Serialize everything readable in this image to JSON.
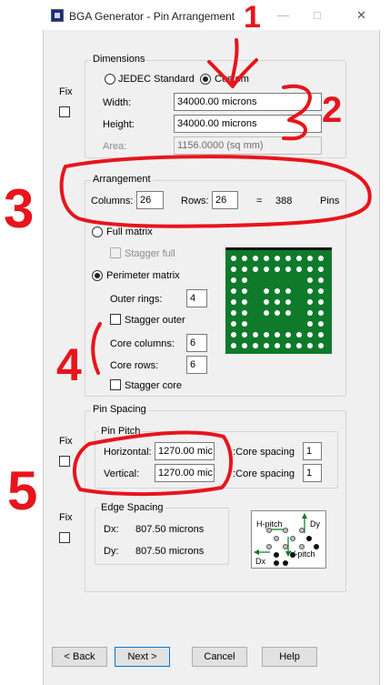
{
  "window": {
    "title": "BGA Generator - Pin Arrangement"
  },
  "fix_labels": [
    "Fix",
    "Fix",
    "Fix"
  ],
  "dimensions": {
    "group_label": "Dimensions",
    "jedec_label": "JEDEC Standard",
    "custom_label": "Custom",
    "selected": "Custom",
    "width_label": "Width:",
    "width_value": "34000.00 microns",
    "height_label": "Height:",
    "height_value": "34000.00 microns",
    "area_label": "Area:",
    "area_value": "1156.0000 (sq mm)"
  },
  "arrangement": {
    "group_label": "Arrangement",
    "columns_label": "Columns:",
    "columns_value": "26",
    "rows_label": "Rows:",
    "rows_value": "26",
    "equals": "=",
    "pin_count": "388",
    "pins_label": "Pins",
    "full_matrix_label": "Full matrix",
    "stagger_full_label": "Stagger full",
    "perimeter_matrix_label": "Perimeter matrix",
    "selected_matrix": "Perimeter matrix",
    "outer_rings_label": "Outer rings:",
    "outer_rings_value": "4",
    "stagger_outer_label": "Stagger outer",
    "core_columns_label": "Core columns:",
    "core_columns_value": "6",
    "core_rows_label": "Core rows:",
    "core_rows_value": "6",
    "stagger_core_label": "Stagger core"
  },
  "pin_spacing": {
    "group_label": "Pin Spacing",
    "pitch_group_label": "Pin Pitch",
    "horizontal_label": "Horizontal:",
    "horizontal_value": "1270.00 mic",
    "vertical_label": "Vertical:",
    "vertical_value": "1270.00 mic",
    "core_spacing_label_1": "Core spacing:",
    "core_spacing_value_1": "1",
    "core_spacing_label_2": "Core spacing:",
    "core_spacing_value_2": "1",
    "edge_group_label": "Edge Spacing",
    "dx_label": "Dx:",
    "dx_value": "807.50 microns",
    "dy_label": "Dy:",
    "dy_value": "807.50 microns",
    "diagram_labels": {
      "h_pitch": "H-pitch",
      "dy": "Dy",
      "v_pitch": "V-pitch",
      "dx": "Dx"
    }
  },
  "buttons": {
    "back": "< Back",
    "next": "Next >",
    "cancel": "Cancel",
    "help": "Help"
  },
  "annotations": [
    "1",
    "2",
    "3",
    "4",
    "5"
  ],
  "colors": {
    "annotation": "#e8141c",
    "preview_board": "#0f7a2a",
    "accent": "#0078d7"
  }
}
